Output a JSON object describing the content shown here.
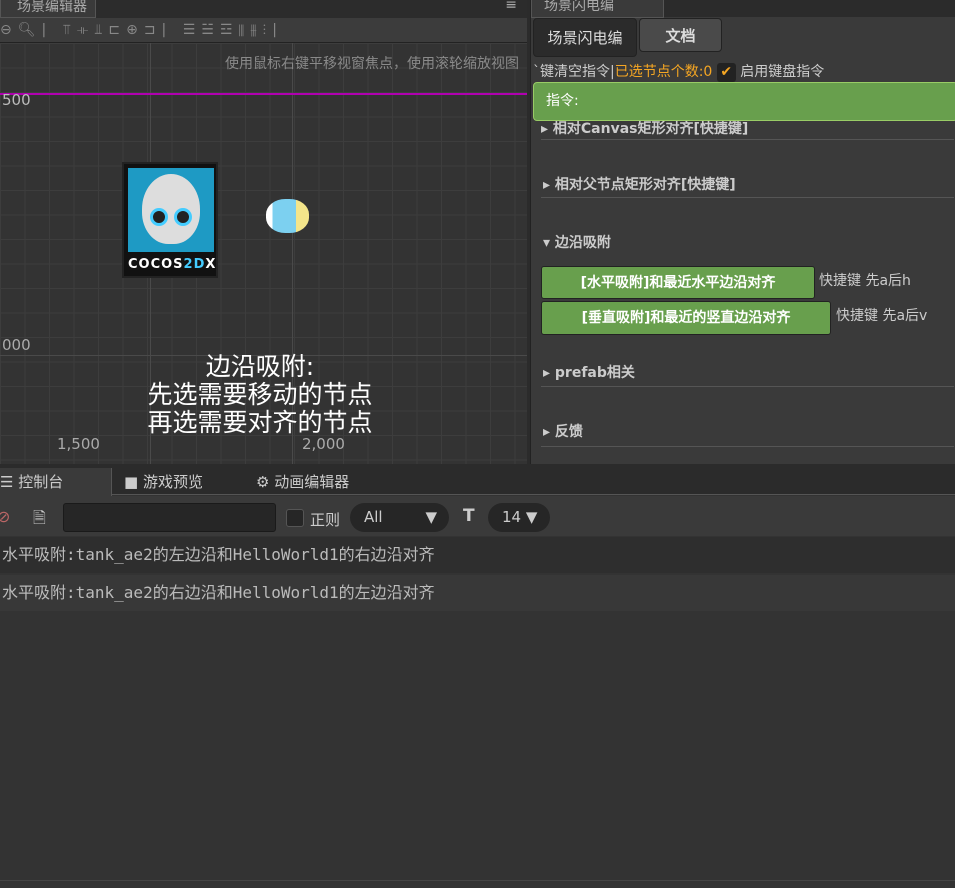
{
  "scene_editor": {
    "tab": "场景编辑器",
    "hint": "使用鼠标右键平移视窗焦点，使用滚轮缩放视图",
    "axis": {
      "y_top": "500",
      "y_mid": "000",
      "x1": "1,500",
      "x2": "2,000"
    },
    "logo_text": "COCOS2DX",
    "overlay": [
      "边沿吸附:",
      "先选需要移动的节点",
      "再选需要对齐的节点"
    ],
    "guide_color": "#b000b0"
  },
  "flash_panel": {
    "tab": "场景闪电编",
    "tabs": [
      "场景闪电编",
      "文档"
    ],
    "status_prefix": "`键清空指令|",
    "selected_count": "已选节点个数:0",
    "enable_keyboard": "启用键盘指令",
    "keyboard_enabled": true,
    "command_label": "指令:",
    "accent": "#689f4d",
    "sections": {
      "canvas": "相对Canvas矩形对齐[快捷键]",
      "parent": "相对父节点矩形对齐[快捷键]",
      "edge": "边沿吸附",
      "prefab": "prefab相关",
      "feedback": "反馈"
    },
    "edge_buttons": [
      {
        "label": "[水平吸附]和最近水平边沿对齐",
        "shortcut": "快捷键 先a后h"
      },
      {
        "label": "[垂直吸附]和最近的竖直边沿对齐",
        "shortcut": "快捷键 先a后v"
      }
    ]
  },
  "console": {
    "tabs": [
      "控制台",
      "游戏预览",
      "动画编辑器"
    ],
    "filter_value": "",
    "regex_label": "正则",
    "level": "All",
    "font_size": "14",
    "logs": [
      "水平吸附:tank_ae2的左边沿和HelloWorld1的右边沿对齐",
      "水平吸附:tank_ae2的右边沿和HelloWorld1的左边沿对齐"
    ]
  }
}
